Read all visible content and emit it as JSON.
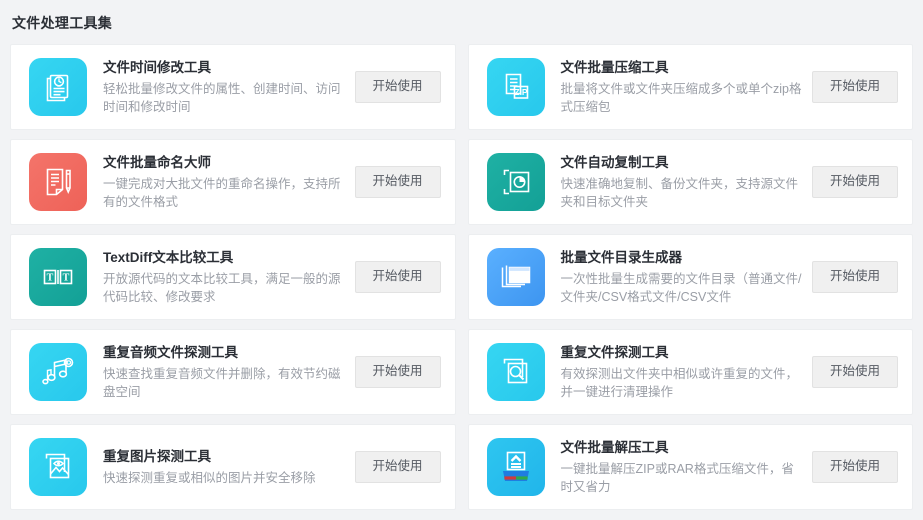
{
  "page": {
    "title": "文件处理工具集",
    "button_label": "开始使用"
  },
  "cards": [
    {
      "title": "文件时间修改工具",
      "desc": "轻松批量修改文件的属性、创建时间、访问时间和修改时间",
      "icon": "document-clock-icon",
      "icon_color": "#2FD0EE",
      "button": "开始使用"
    },
    {
      "title": "文件批量压缩工具",
      "desc": "批量将文件或文件夹压缩成多个或单个zip格式压缩包",
      "icon": "zip-file-icon",
      "icon_color": "#2EC4EC",
      "button": "开始使用"
    },
    {
      "title": "文件批量命名大师",
      "desc": "一键完成对大批文件的重命名操作，支持所有的文件格式",
      "icon": "document-pencil-icon",
      "icon_color": "#F0675D",
      "button": "开始使用"
    },
    {
      "title": "文件自动复制工具",
      "desc": "快速准确地复制、备份文件夹，支持源文件夹和目标文件夹",
      "icon": "copy-clock-icon",
      "icon_color": "#18A89C",
      "button": "开始使用"
    },
    {
      "title": "TextDiff文本比较工具",
      "desc": "开放源代码的文本比较工具，满足一般的源代码比较、修改要求",
      "icon": "text-diff-icon",
      "icon_color": "#17A79B",
      "button": "开始使用"
    },
    {
      "title": "批量文件目录生成器",
      "desc": "一次性批量生成需要的文件目录（普通文件/文件夹/CSV格式文件/CSV文件",
      "icon": "stacked-folders-icon",
      "icon_color": "#4A9FF5",
      "button": "开始使用"
    },
    {
      "title": "重复音频文件探测工具",
      "desc": "快速查找重复音频文件并删除，有效节约磁盘空间",
      "icon": "music-note-icon",
      "icon_color": "#34CDEE",
      "button": "开始使用"
    },
    {
      "title": "重复文件探测工具",
      "desc": "有效探测出文件夹中相似或许重复的文件，并一键进行清理操作",
      "icon": "file-search-icon",
      "icon_color": "#2CC9EC",
      "button": "开始使用"
    },
    {
      "title": "重复图片探测工具",
      "desc": "快速探测重复或相似的图片并安全移除",
      "icon": "image-eye-icon",
      "icon_color": "#33CEEE",
      "button": "开始使用"
    },
    {
      "title": "文件批量解压工具",
      "desc": "一键批量解压ZIP或RAR格式压缩文件，省时又省力",
      "icon": "unzip-box-icon",
      "icon_color": "#26BEEB",
      "button": "开始使用"
    }
  ]
}
